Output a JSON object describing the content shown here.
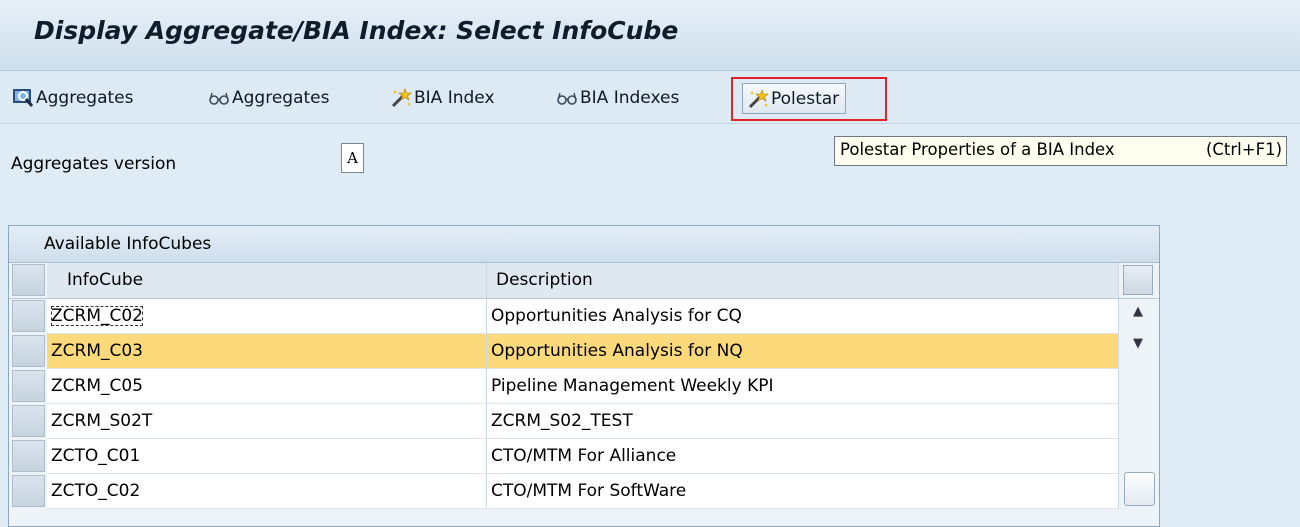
{
  "window": {
    "title": "Display Aggregate/BIA Index: Select InfoCube"
  },
  "toolbar": {
    "buttons": [
      {
        "label": "Aggregates",
        "icon": "monitor-aggregates-icon"
      },
      {
        "label": "Aggregates",
        "icon": "glasses-display-icon"
      },
      {
        "label": "BIA Index",
        "icon": "magic-wand-icon"
      },
      {
        "label": "BIA Indexes",
        "icon": "glasses-display-icon"
      },
      {
        "label": "Polestar",
        "icon": "magic-wand-icon"
      }
    ]
  },
  "tooltip": {
    "text": "Polestar Properties of a BIA Index",
    "shortcut": "(Ctrl+F1)"
  },
  "form": {
    "aggregates_version_label": "Aggregates version",
    "aggregates_version_value": "A"
  },
  "table": {
    "title": "Available InfoCubes",
    "columns": [
      "InfoCube",
      "Description"
    ],
    "rows": [
      {
        "infocube": "ZCRM_C02",
        "description": "Opportunities Analysis for CQ"
      },
      {
        "infocube": "ZCRM_C03",
        "description": "Opportunities Analysis for NQ"
      },
      {
        "infocube": "ZCRM_C05",
        "description": "Pipeline Management Weekly KPI"
      },
      {
        "infocube": "ZCRM_S02T",
        "description": "ZCRM_S02_TEST"
      },
      {
        "infocube": "ZCTO_C01",
        "description": "CTO/MTM For Alliance"
      },
      {
        "infocube": "ZCTO_C02",
        "description": "CTO/MTM For SoftWare"
      }
    ]
  },
  "colors": {
    "highlight_row": "#fcd97a",
    "focus_frame": "#e0242a",
    "background": "#dfebf5"
  }
}
